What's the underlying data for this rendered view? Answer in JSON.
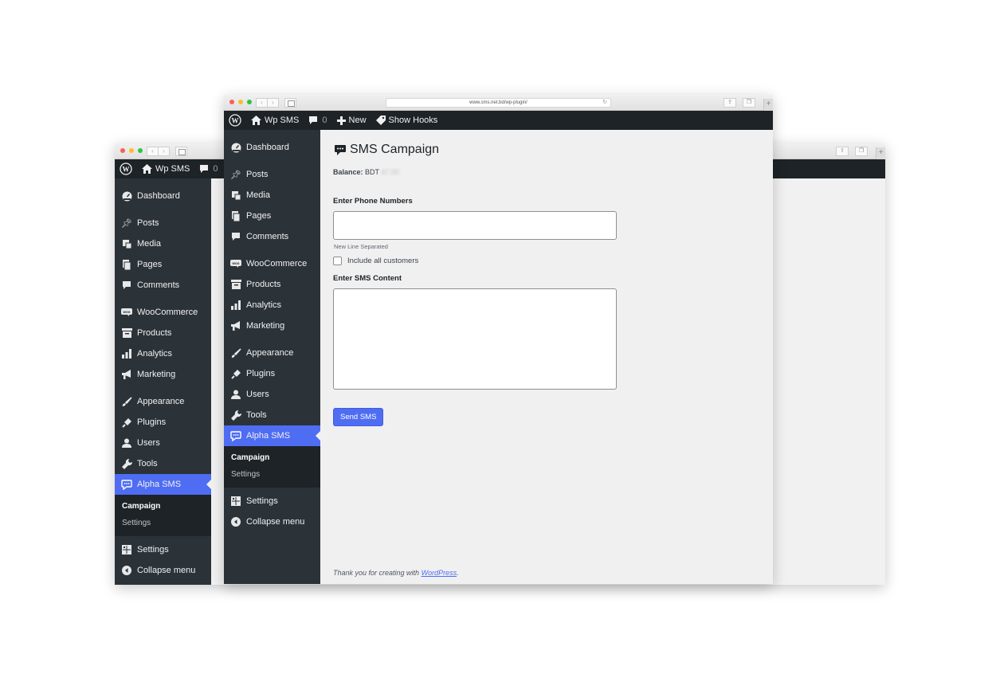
{
  "browser": {
    "url": "www.sms.net.bd/wp-plugin/"
  },
  "adminbar": {
    "site_name": "Wp SMS",
    "comment_count": "0",
    "new_label": "New",
    "hooks_label": "Show Hooks"
  },
  "menu": {
    "items": [
      {
        "label": "Dashboard",
        "icon": "dashboard-icon"
      },
      {
        "label": "Posts",
        "icon": "pin-icon"
      },
      {
        "label": "Media",
        "icon": "media-icon"
      },
      {
        "label": "Pages",
        "icon": "pages-icon"
      },
      {
        "label": "Comments",
        "icon": "comment-icon"
      },
      {
        "label": "WooCommerce",
        "icon": "woo-icon"
      },
      {
        "label": "Products",
        "icon": "archive-icon"
      },
      {
        "label": "Analytics",
        "icon": "bar-chart-icon"
      },
      {
        "label": "Marketing",
        "icon": "megaphone-icon"
      },
      {
        "label": "Appearance",
        "icon": "brush-icon"
      },
      {
        "label": "Plugins",
        "icon": "plug-icon"
      },
      {
        "label": "Users",
        "icon": "user-icon"
      },
      {
        "label": "Tools",
        "icon": "wrench-icon"
      },
      {
        "label": "Alpha SMS",
        "icon": "chat-icon"
      }
    ],
    "submenu": {
      "campaign": "Campaign",
      "settings": "Settings"
    },
    "settings_label": "Settings",
    "collapse_label": "Collapse menu"
  },
  "page": {
    "title": "SMS Campaign",
    "balance_label": "Balance:",
    "balance_currency": "BDT",
    "balance_value": "47.00",
    "phone_label": "Enter Phone Numbers",
    "phone_value": "",
    "phone_hint": "New Line Separated",
    "include_customers_label": "Include all customers",
    "include_customers_checked": false,
    "sms_label": "Enter SMS Content",
    "sms_value": "",
    "send_button": "Send SMS"
  },
  "footer": {
    "text": "Thank you for creating with",
    "link": "WordPress",
    "period": "."
  },
  "colors": {
    "accent": "#4f6df3",
    "admin_bar": "#1d2327",
    "menu_bg": "#2c3338"
  }
}
